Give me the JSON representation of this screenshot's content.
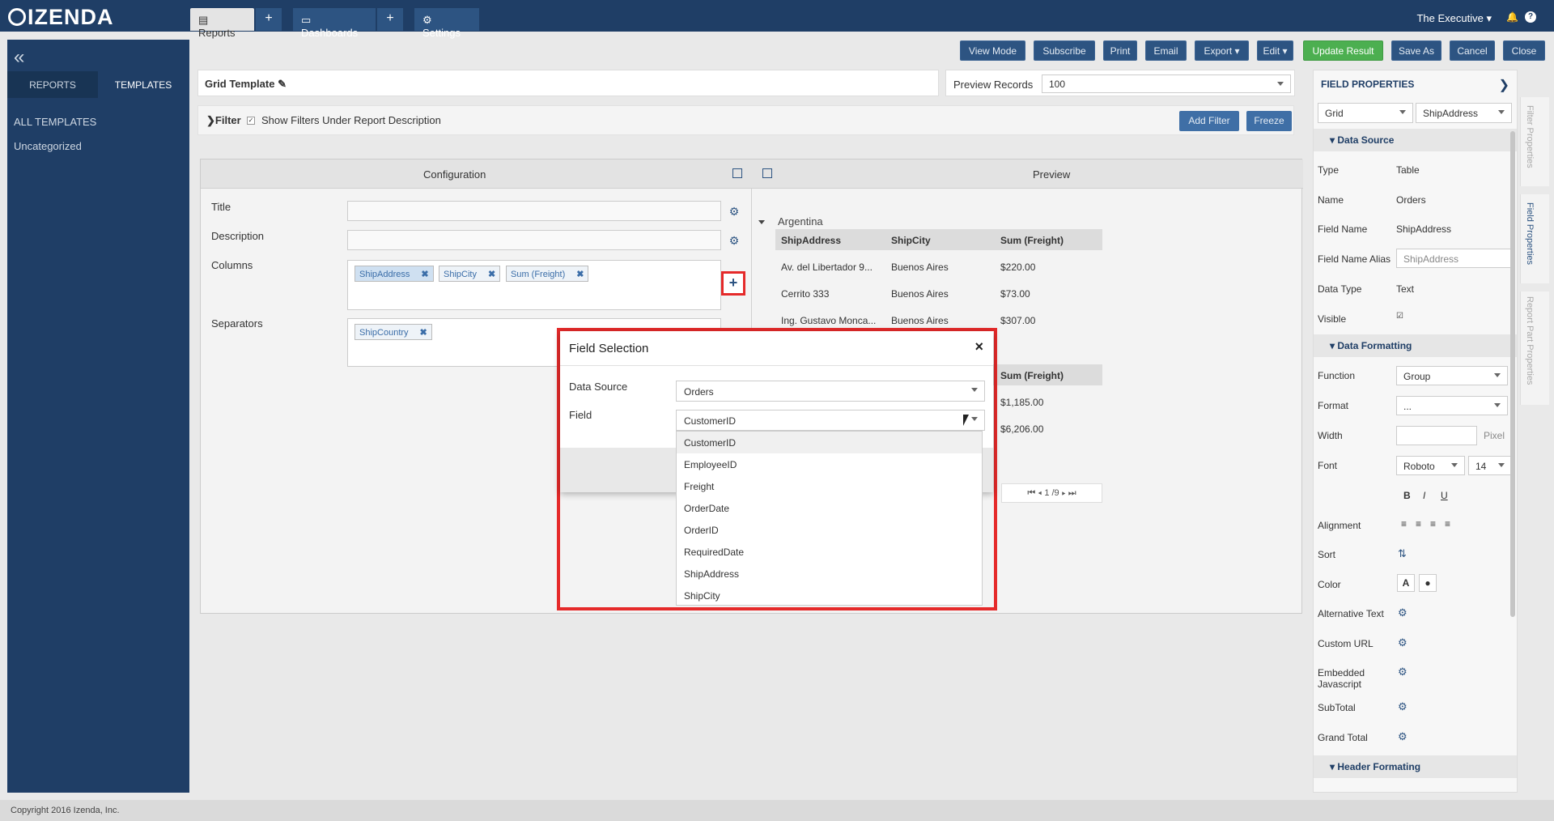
{
  "brand": {
    "logo_text": "IZENDA"
  },
  "top_nav": {
    "reports": "Reports",
    "dashboards": "Dashboards",
    "settings": "Settings",
    "user": "The Executive",
    "plus": "+"
  },
  "sidebar": {
    "collapse": "«",
    "tabs": [
      "REPORTS",
      "TEMPLATES"
    ],
    "links": [
      "ALL TEMPLATES",
      "Uncategorized"
    ]
  },
  "toolbar": {
    "buttons": [
      "View Mode",
      "Subscribe",
      "Print",
      "Email",
      "Export",
      "Edit",
      "Update Result",
      "Save As",
      "Cancel",
      "Close"
    ]
  },
  "template": {
    "name": "Grid Template"
  },
  "preview_records": {
    "label": "Preview Records",
    "value": "100"
  },
  "filter": {
    "label": "Filter",
    "show_under_desc": "Show Filters Under Report Description",
    "add_filter": "Add Filter",
    "freeze": "Freeze"
  },
  "config": {
    "title": "Configuration",
    "labels": {
      "title": "Title",
      "description": "Description",
      "columns": "Columns",
      "separators": "Separators"
    },
    "columns": [
      "ShipAddress",
      "ShipCity",
      "Sum (Freight)"
    ],
    "separators": [
      "ShipCountry"
    ]
  },
  "preview": {
    "title": "Preview",
    "group": "Argentina",
    "headers": [
      "ShipAddress",
      "ShipCity",
      "Sum (Freight)"
    ],
    "rows": [
      [
        "Av. del Libertador 9...",
        "Buenos Aires",
        "$220.00"
      ],
      [
        "Cerrito 333",
        "Buenos Aires",
        "$73.00"
      ],
      [
        "Ing. Gustavo Monca...",
        "Buenos Aires",
        "$307.00"
      ]
    ],
    "second_header": "Sum (Freight)",
    "second_rows": [
      "$1,185.00",
      "$6,206.00"
    ],
    "pager": "1 /9"
  },
  "field_properties": {
    "title": "FIELD PROPERTIES",
    "grid_select": "Grid",
    "field_select": "ShipAddress",
    "data_source_section": "Data Source",
    "rows": [
      {
        "label": "Type",
        "value": "Table"
      },
      {
        "label": "Name",
        "value": "Orders"
      },
      {
        "label": "Field Name",
        "value": "ShipAddress"
      },
      {
        "label": "Field Name Alias",
        "value": "ShipAddress"
      },
      {
        "label": "Data Type",
        "value": "Text"
      },
      {
        "label": "Visible",
        "value": ""
      }
    ],
    "formatting_section": "Data Formatting",
    "function": {
      "label": "Function",
      "value": "Group"
    },
    "format": {
      "label": "Format",
      "value": "..."
    },
    "width": {
      "label": "Width",
      "unit": "Pixel"
    },
    "font": {
      "label": "Font",
      "family": "Roboto",
      "size": "14"
    },
    "style_buttons": [
      "B",
      "I",
      "U"
    ],
    "labels": [
      "Alignment",
      "Sort",
      "Color",
      "Alternative Text",
      "Custom URL",
      "Embedded Javascript",
      "SubTotal",
      "Grand Total"
    ],
    "header_section": "Header Formating",
    "color_letter": "A"
  },
  "side_vtabs": [
    "Filter Properties",
    "Field Properties",
    "Report Part Properties"
  ],
  "footer": {
    "copyright": "Copyright 2016 Izenda, Inc."
  },
  "modal": {
    "title": "Field Selection",
    "close": "×",
    "data_source_label": "Data Source",
    "data_source_value": "Orders",
    "field_label": "Field",
    "field_value": "CustomerID",
    "options": [
      "CustomerID",
      "EmployeeID",
      "Freight",
      "OrderDate",
      "OrderID",
      "RequiredDate",
      "ShipAddress",
      "ShipCity"
    ]
  }
}
